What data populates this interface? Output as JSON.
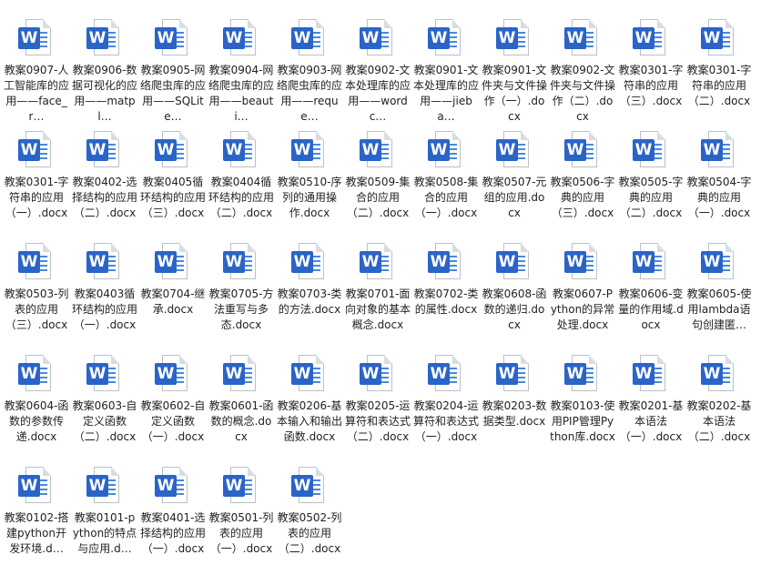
{
  "window": {
    "title": "Documents",
    "files": [
      {
        "name": "教案0907-人工智能库的应用——face_r…"
      },
      {
        "name": "教案0906-数据可视化的应用——matpl…"
      },
      {
        "name": "教案0905-网络爬虫库的应用——SQLite…"
      },
      {
        "name": "教案0904-网络爬虫库的应用——beauti…"
      },
      {
        "name": "教案0903-网络爬虫库的应用——reque…"
      },
      {
        "name": "教案0902-文本处理库的应用——wordc…"
      },
      {
        "name": "教案0901-文本处理库的应用——jieba…"
      },
      {
        "name": "教案0901-文件夹与文件操作（一）.docx"
      },
      {
        "name": "教案0902-文件夹与文件操作（二）.docx"
      },
      {
        "name": "教案0301-字符串的应用（三）.docx"
      },
      {
        "name": "教案0301-字符串的应用（二）.docx"
      },
      {
        "name": "教案0301-字符串的应用（一）.docx"
      },
      {
        "name": "教案0402-选择结构的应用（二）.docx"
      },
      {
        "name": "教案0405循环结构的应用（三）.docx"
      },
      {
        "name": "教案0404循环结构的应用（二）.docx"
      },
      {
        "name": "教案0510-序列的通用操作.docx"
      },
      {
        "name": "教案0509-集合的应用（二）.docx"
      },
      {
        "name": "教案0508-集合的应用（一）.docx"
      },
      {
        "name": "教案0507-元组的应用.docx"
      },
      {
        "name": "教案0506-字典的应用（三）.docx"
      },
      {
        "name": "教案0505-字典的应用（二）.docx"
      },
      {
        "name": "教案0504-字典的应用（一）.docx"
      },
      {
        "name": "教案0503-列表的应用（三）.docx"
      },
      {
        "name": "教案0403循环结构的应用（一）.docx"
      },
      {
        "name": "教案0704-继承.docx"
      },
      {
        "name": "教案0705-方法重写与多态.docx"
      },
      {
        "name": "教案0703-类的方法.docx"
      },
      {
        "name": "教案0701-面向对象的基本概念.docx"
      },
      {
        "name": "教案0702-类的属性.docx"
      },
      {
        "name": "教案0608-函数的递归.docx"
      },
      {
        "name": "教案0607-Python的异常处理.docx"
      },
      {
        "name": "教案0606-变量的作用域.docx"
      },
      {
        "name": "教案0605-使用lambda语句创建匿…"
      },
      {
        "name": "教案0604-函数的参数传递.docx"
      },
      {
        "name": "教案0603-自定义函数（二）.docx"
      },
      {
        "name": "教案0602-自定义函数（一）.docx"
      },
      {
        "name": "教案0601-函数的概念.docx"
      },
      {
        "name": "教案0206-基本输入和输出函数.docx"
      },
      {
        "name": "教案0205-运算符和表达式（二）.docx"
      },
      {
        "name": "教案0204-运算符和表达式（一）.docx"
      },
      {
        "name": "教案0203-数据类型.docx"
      },
      {
        "name": "教案0103-使用PIP管理Python库.docx"
      },
      {
        "name": "教案0201-基本语法（一）.docx"
      },
      {
        "name": "教案0202-基本语法（二）.docx"
      },
      {
        "name": "教案0102-搭建python开发环境.d…"
      },
      {
        "name": "教案0101-python的特点与应用.d…"
      },
      {
        "name": "教案0401-选择结构的应用（一）.docx"
      },
      {
        "name": "教案0501-列表的应用（一）.docx"
      },
      {
        "name": "教案0502-列表的应用（二）.docx"
      }
    ]
  },
  "icon": {
    "name": "word-doc-icon",
    "letter": "W",
    "accent": "#2b64c9"
  }
}
